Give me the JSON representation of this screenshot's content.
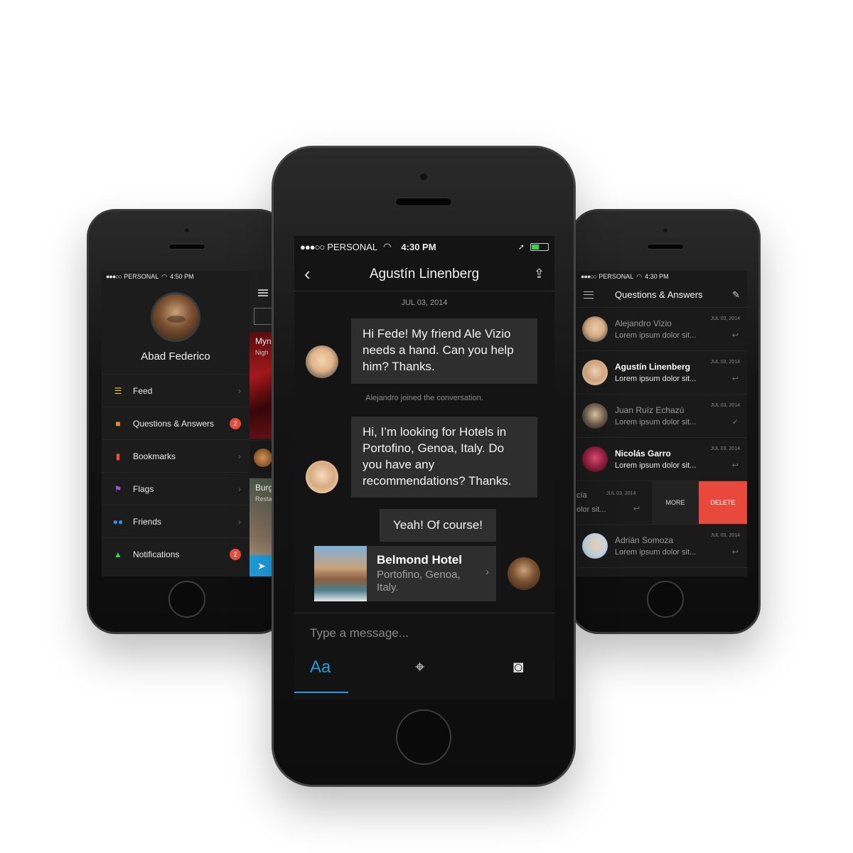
{
  "left_phone": {
    "status": {
      "carrier": "PERSONAL",
      "time": "4:50 PM"
    },
    "profile": {
      "name": "Abad Federico"
    },
    "menu": [
      {
        "label": "Feed",
        "icon": "list-icon",
        "badge": "",
        "icon_color": "#f2c230"
      },
      {
        "label": "Questions & Answers",
        "icon": "chat-bubbles-icon",
        "badge": "2",
        "icon_color": "#f08a24"
      },
      {
        "label": "Bookmarks",
        "icon": "bookmark-icon",
        "badge": "",
        "icon_color": "#e94b3c"
      },
      {
        "label": "Flags",
        "icon": "flag-icon",
        "badge": "",
        "icon_color": "#8e5cc8"
      },
      {
        "label": "Friends",
        "icon": "people-icon",
        "badge": "",
        "icon_color": "#3a8ee6"
      },
      {
        "label": "Notifications",
        "icon": "bell-icon",
        "badge": "2",
        "icon_color": "#3ecf4a"
      }
    ],
    "peek": {
      "item1_title": "Myn",
      "item1_sub": "Nigh",
      "item2_title": "Burg",
      "item2_sub": "Resta"
    }
  },
  "center_phone": {
    "status": {
      "carrier": "PERSONAL",
      "time": "4:30 PM"
    },
    "header": {
      "title": "Agustín Linenberg"
    },
    "date": "JUL 03, 2014",
    "messages": [
      {
        "text": "Hi Fede! My friend Ale Vizio needs a hand. Can you help him? Thanks."
      },
      {
        "text": "Hi, I’m looking for Hotels in Portofino, Genoa, Italy. Do you have any recommendations? Thanks."
      }
    ],
    "system_note": "Alejandro joined the conversation.",
    "reply": "Yeah! Of course!",
    "hotel": {
      "name": "Belmond Hotel",
      "location": "Portofino, Genoa, Italy."
    },
    "composer": {
      "placeholder": "Type a message...",
      "text_tool": "Aa"
    }
  },
  "right_phone": {
    "status": {
      "carrier": "PERSONAL",
      "time": "4:30 PM"
    },
    "header": {
      "title": "Questions & Answers"
    },
    "conversations": [
      {
        "name": "Alejandro Vizio",
        "preview": "Lorem ipsum dolor sit...",
        "date": "JUL 03, 2014",
        "status": "↩",
        "unread": false
      },
      {
        "name": "Agustín Linenberg",
        "preview": "Lorem ipsum dolor sit...",
        "date": "JUL 03, 2014",
        "status": "↩",
        "unread": true
      },
      {
        "name": "Juan Ruíz Echazú",
        "preview": "Lorem ipsum dolor sit...",
        "date": "JUL 03, 2014",
        "status": "✓",
        "unread": false
      },
      {
        "name": "Nicolás Garro",
        "preview": "Lorem ipsum dolor sit...",
        "date": "JUL 03, 2014",
        "status": "↩",
        "unread": true
      }
    ],
    "swiped": {
      "name_fragment": "cía",
      "preview_fragment": "olor sit...",
      "date": "JUL 03, 2014",
      "more": "MORE",
      "delete": "DELETE"
    },
    "last": {
      "name": "Adrián Somoza",
      "preview": "Lorem ipsum dolor sit...",
      "date": "JUL 03, 2014",
      "status": "↩"
    }
  }
}
